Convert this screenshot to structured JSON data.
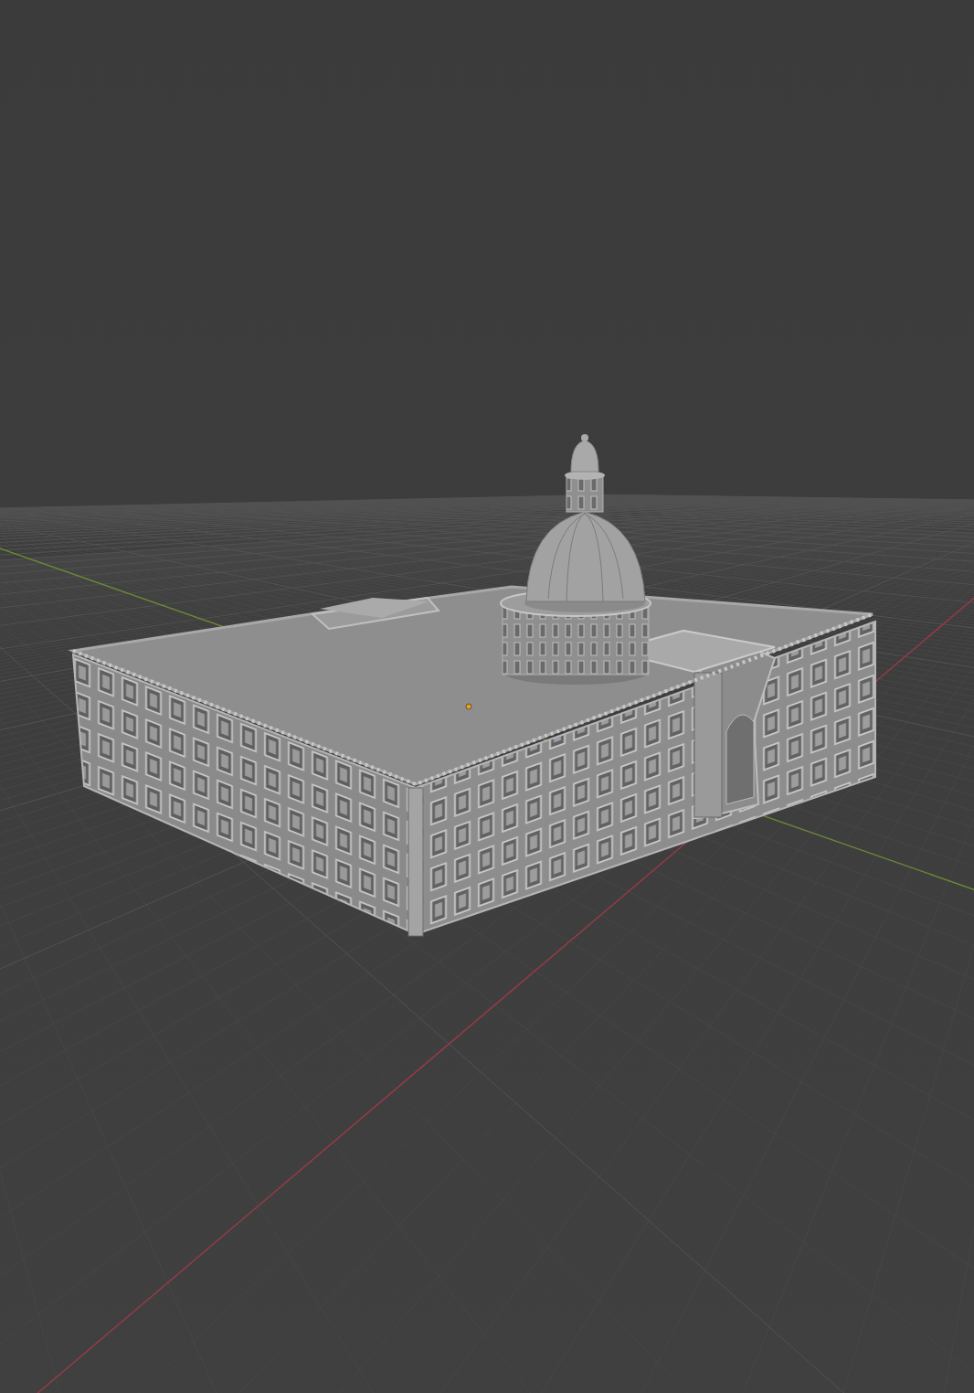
{
  "viewport": {
    "grid": true,
    "show_origin": true,
    "axes": [
      {
        "kind": "x_axis",
        "color": "#9a3a45"
      },
      {
        "kind": "y_axis",
        "color": "#6a8a32"
      }
    ]
  }
}
